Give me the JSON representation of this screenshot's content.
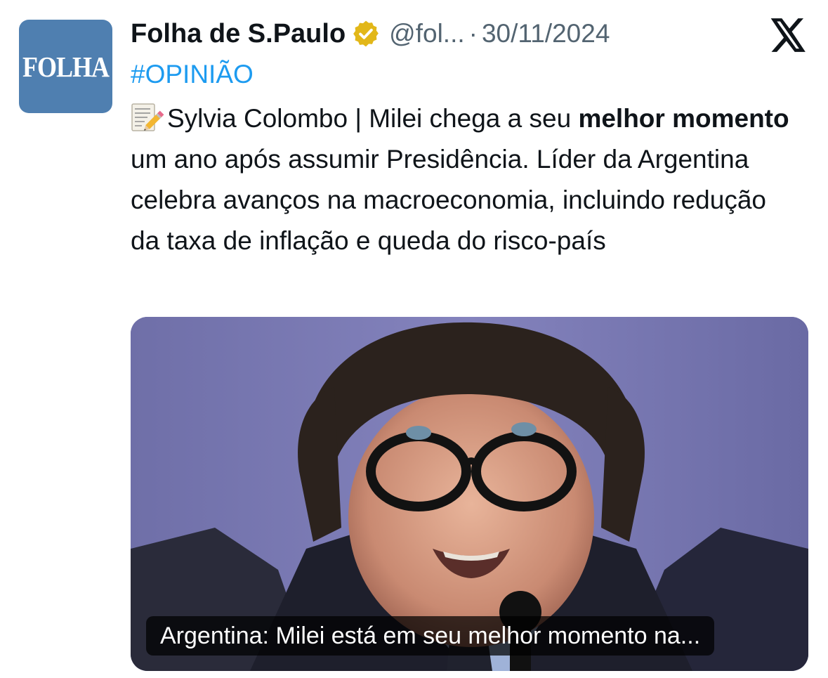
{
  "account": {
    "avatar_text": "FOLHA",
    "name": "Folha de S.Paulo",
    "handle": "@fol...",
    "separator": "·",
    "date": "30/11/2024",
    "avatar_color": "#4f7fb0",
    "verified_badge_color": "#e2b719"
  },
  "tweet": {
    "hashtag": "#OPINIÃO",
    "emoji_icon": "memo-pencil-icon",
    "text_part1": "Sylvia Colombo | Milei chega a seu ",
    "text_bold1": "melhor momento",
    "text_part2": " um ano após assumir Presidência. Líder da Argentina celebra avanços na macroeconomia, incluindo redução da taxa de inflação e queda do risco-país"
  },
  "card": {
    "caption": "Argentina: Milei está em seu melhor momento na..."
  },
  "colors": {
    "text": "#0f1419",
    "secondary": "#536471",
    "link": "#1d9bf0"
  }
}
